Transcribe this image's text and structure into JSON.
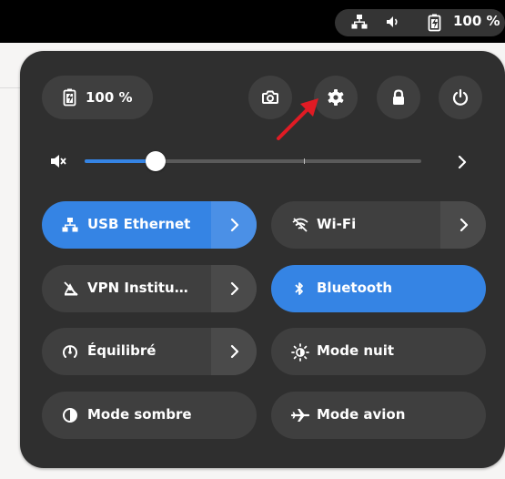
{
  "topbar": {
    "battery_percent": "100 %",
    "icons": [
      "network-wired-icon",
      "speaker-icon",
      "battery-icon"
    ]
  },
  "panel": {
    "battery": {
      "label": "100 %"
    },
    "actions": [
      "screenshot-button",
      "settings-button",
      "lock-button",
      "power-button"
    ],
    "volume": {
      "level": 0.21,
      "muted_icon": "speaker-muted-icon"
    },
    "tiles": [
      {
        "label": "USB Ethernet",
        "active": true,
        "has_menu": true
      },
      {
        "label": "Wi-Fi",
        "active": false,
        "has_menu": true
      },
      {
        "label": "VPN Institu…",
        "active": false,
        "has_menu": true
      },
      {
        "label": "Bluetooth",
        "active": true,
        "has_menu": false
      },
      {
        "label": "Équilibré",
        "active": false,
        "has_menu": true
      },
      {
        "label": "Mode nuit",
        "active": false,
        "has_menu": false
      },
      {
        "label": "Mode sombre",
        "active": false,
        "has_menu": false
      },
      {
        "label": "Mode avion",
        "active": false,
        "has_menu": false
      }
    ]
  },
  "colors": {
    "accent": "#3584e4",
    "panel_bg": "#2f2f2f",
    "tile_bg": "#3f3f3f",
    "annotation_arrow": "#e01b24"
  }
}
